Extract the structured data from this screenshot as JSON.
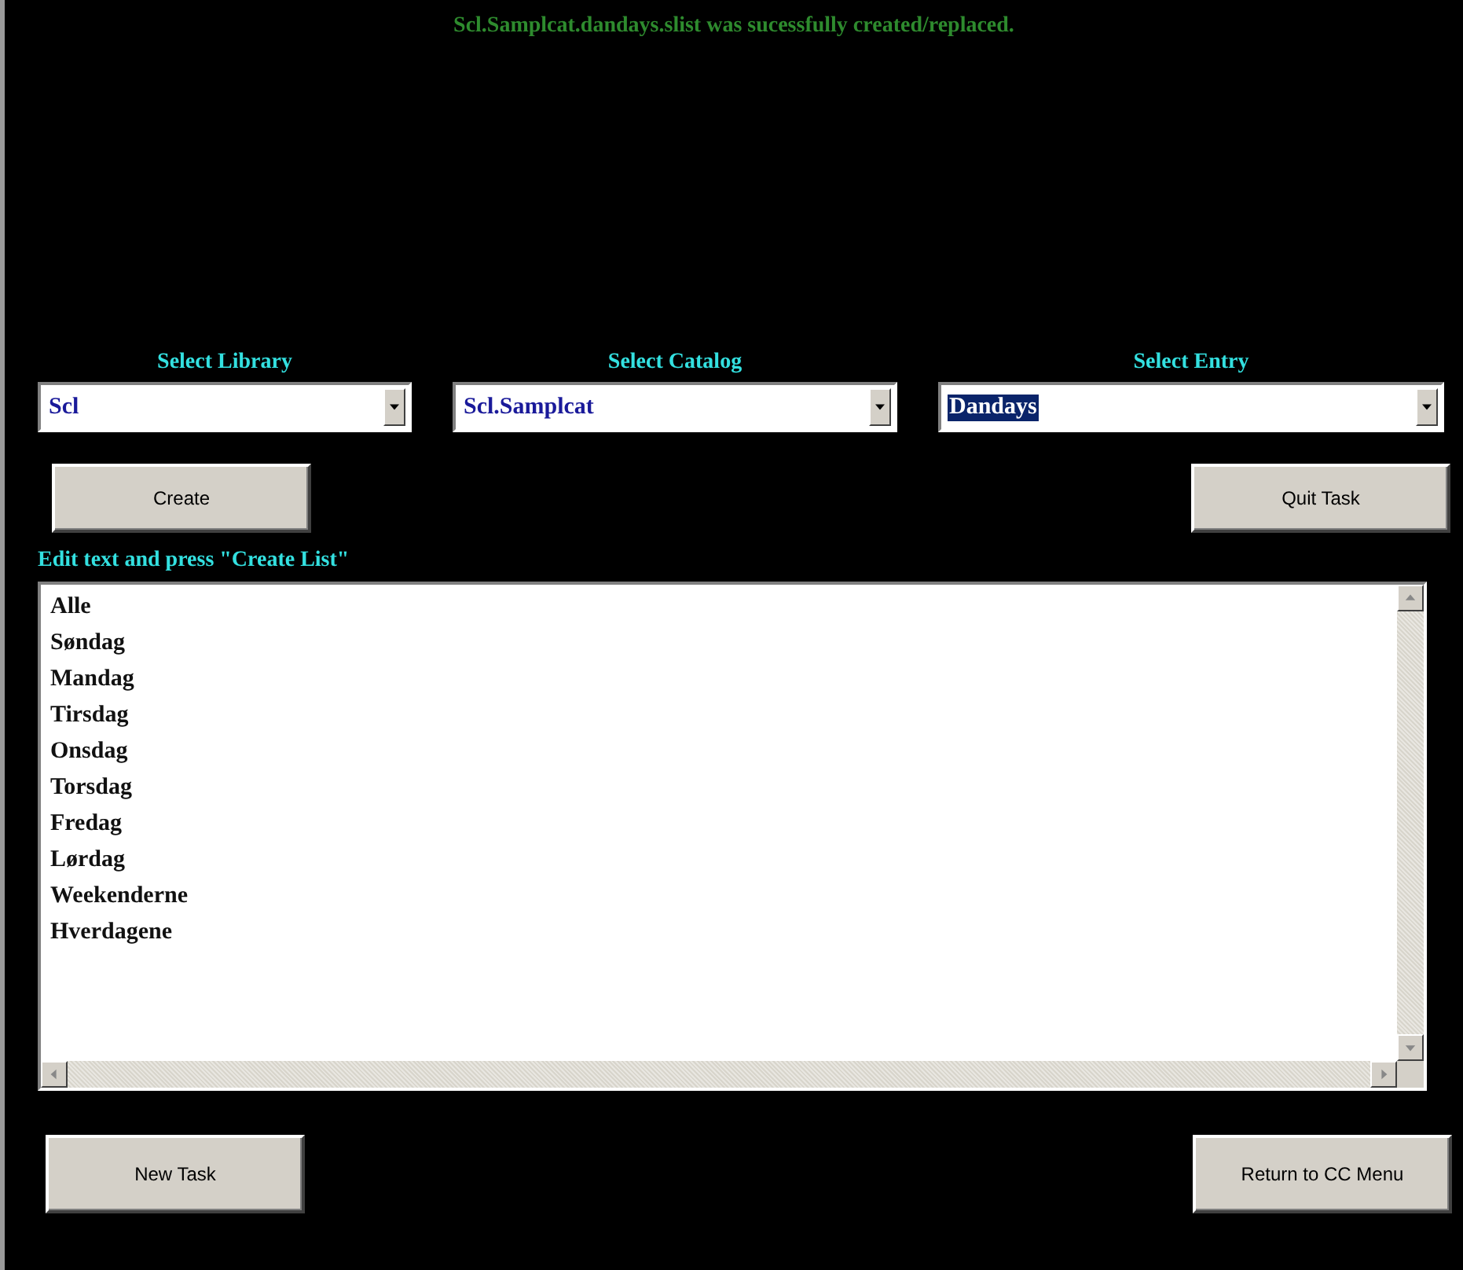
{
  "message": "Scl.Samplcat.dandays.slist was sucessfully created/replaced.",
  "selectors": [
    {
      "label": "Select Library",
      "value": "Scl",
      "highlighted": false
    },
    {
      "label": "Select Catalog",
      "value": "Scl.Samplcat",
      "highlighted": false
    },
    {
      "label": "Select Entry",
      "value": "Dandays",
      "highlighted": true
    }
  ],
  "top_buttons": [
    "Create",
    "Quit Task"
  ],
  "editor": {
    "label": "Edit text and press \"Create List\"",
    "lines": [
      "Alle",
      "Søndag",
      "Mandag",
      "Tirsdag",
      "Onsdag",
      "Torsdag",
      "Fredag",
      "Lørdag",
      "Weekenderne",
      "Hverdagene"
    ]
  },
  "bottom_buttons": [
    "New Task",
    "Return to CC Menu"
  ]
}
